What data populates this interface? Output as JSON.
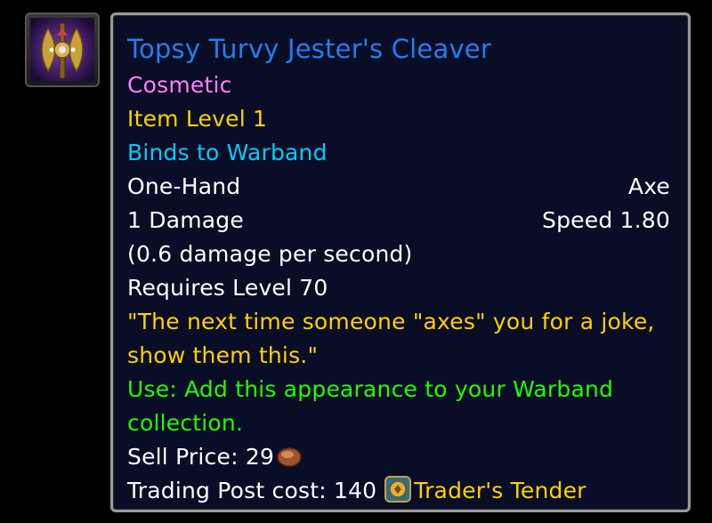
{
  "item": {
    "icon": "jester-axe-icon",
    "name": "Topsy Turvy Jester's Cleaver",
    "appearance_type": "Cosmetic",
    "item_level": "Item Level 1",
    "binding": "Binds to Warband",
    "slot": "One-Hand",
    "weapon_type": "Axe",
    "damage": "1 Damage",
    "speed": "Speed 1.80",
    "dps": "(0.6 damage per second)",
    "requires_level": "Requires Level 70",
    "flavor_text": "\"The next time someone \"axes\" you for a joke, show them this.\"",
    "use_text": "Use: Add this appearance to your Warband collection.",
    "sell_price_label": "Sell Price: 29",
    "sell_price_currency": "copper-coin-icon",
    "trading_post_label": "Trading Post cost: 140",
    "trading_post_currency": "Trader's Tender",
    "trading_post_icon": "traders-tender-icon"
  },
  "colors": {
    "title": "#1f80ef",
    "cosmetic": "#ff80ff",
    "gold": "#ffd100",
    "binding": "#00ccff",
    "use": "#1eff00",
    "tooltip_bg": "#0a0d26"
  }
}
